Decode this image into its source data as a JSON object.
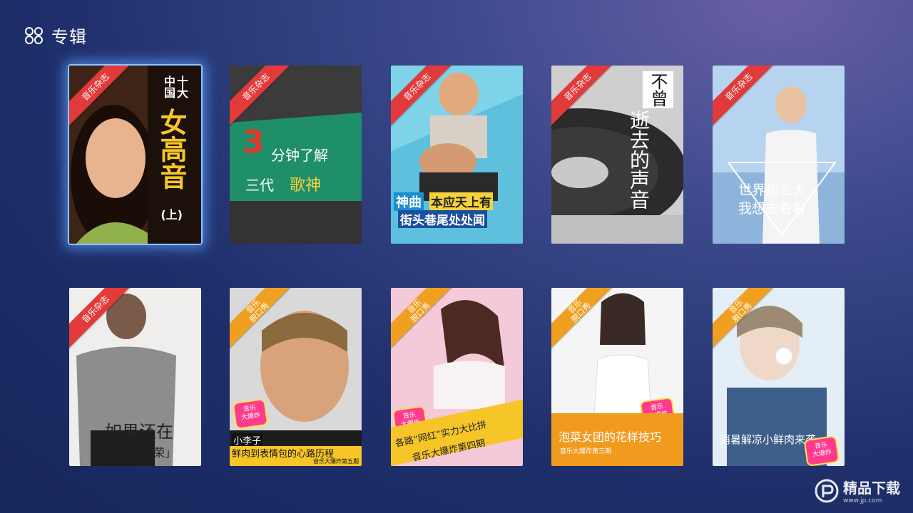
{
  "header": {
    "title": "专辑",
    "icon": "apps-grid-icon"
  },
  "cards": [
    {
      "tag": "音乐杂志",
      "lines": [
        "中国",
        "十大",
        "女高音",
        "(上)"
      ]
    },
    {
      "tag": "音乐杂志",
      "lines": [
        "3",
        "分钟了解",
        "三代",
        "歌神"
      ]
    },
    {
      "tag": "音乐杂志",
      "lines": [
        "神曲",
        "本应天上有",
        "街头巷尾处处闻"
      ]
    },
    {
      "tag": "音乐杂志",
      "lines": [
        "不曾",
        "逝去的声音"
      ]
    },
    {
      "tag": "音乐杂志",
      "lines": [
        "世界那么大",
        "我想去看看"
      ]
    },
    {
      "tag": "音乐杂志",
      "lines": [
        "如果还在",
        "「张国荣」"
      ]
    },
    {
      "tag": "音乐\n脱口秀",
      "logo": "音乐\n大爆炸",
      "lines": [
        "小李子",
        "鲜肉到表情包的心路历程",
        "音乐大爆炸第五期"
      ]
    },
    {
      "tag": "音乐\n脱口秀",
      "logo": "音乐\n大爆炸",
      "lines": [
        "各路“网红”实力大比拼",
        "音乐大爆炸第四期"
      ]
    },
    {
      "tag": "音乐\n脱口秀",
      "logo": "音乐\n大爆炸",
      "lines": [
        "泡菜女团的花样技巧",
        "音乐大爆炸第三期"
      ]
    },
    {
      "tag": "音乐\n脱口秀",
      "logo": "音乐\n大爆炸",
      "lines": [
        "消暑解凉小鲜肉来袭"
      ]
    }
  ],
  "watermark": {
    "text": "精品下载",
    "url": "www.jp.com"
  },
  "colors": {
    "accent_red": "#e23a3a",
    "accent_orange": "#f0a020",
    "focus_glow": "#5aa0ff"
  }
}
